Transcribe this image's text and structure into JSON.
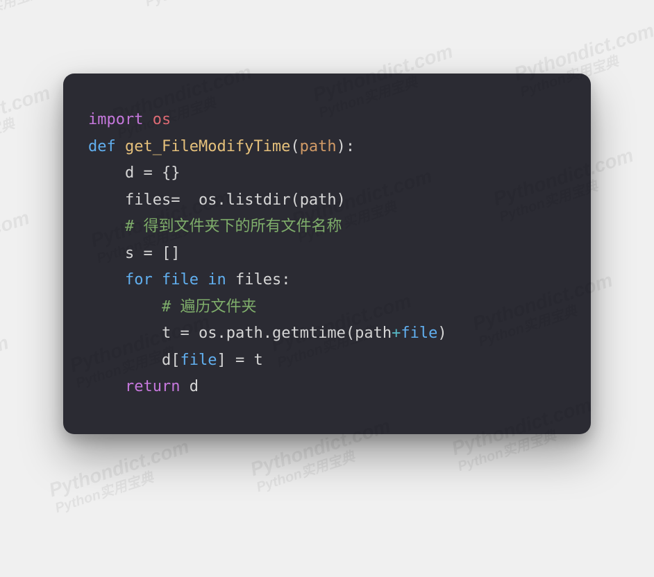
{
  "watermark": {
    "text_en": "Pythondict.com",
    "text_cn": "Python实用宝典"
  },
  "code": {
    "l1": {
      "import": "import",
      "os": "os"
    },
    "l2": {
      "def": "def",
      "fn": "get_FileModifyTime",
      "lp": "(",
      "param": "path",
      "rp": ")",
      "colon": ":"
    },
    "l3": {
      "d": "d",
      "eq": " = ",
      "braces": "{}"
    },
    "l4": {
      "files": "files",
      "eq": "= ",
      "os": "os",
      "dot1": ".",
      "listdir": "listdir",
      "lp": "(",
      "path": "path",
      "rp": ")"
    },
    "l5": {
      "comment": "# 得到文件夹下的所有文件名称"
    },
    "l6": {
      "s": "s",
      "eq": " = ",
      "brackets": "[]"
    },
    "l7": {
      "for": "for",
      "file": "file",
      "in": "in",
      "files": "files",
      "colon": ":"
    },
    "l8": {
      "comment": "# 遍历文件夹"
    },
    "l9": {
      "t": "t",
      "eq": " = ",
      "os": "os",
      "dot1": ".",
      "path": "path",
      "dot2": ".",
      "getmtime": "getmtime",
      "lp": "(",
      "arg_path": "path",
      "plus": "+",
      "arg_file": "file",
      "rp": ")"
    },
    "l10": {
      "d": "d",
      "lb": "[",
      "file": "file",
      "rb": "]",
      "eq": " = ",
      "t": "t"
    },
    "l11": {
      "return": "return",
      "d": "d"
    }
  }
}
